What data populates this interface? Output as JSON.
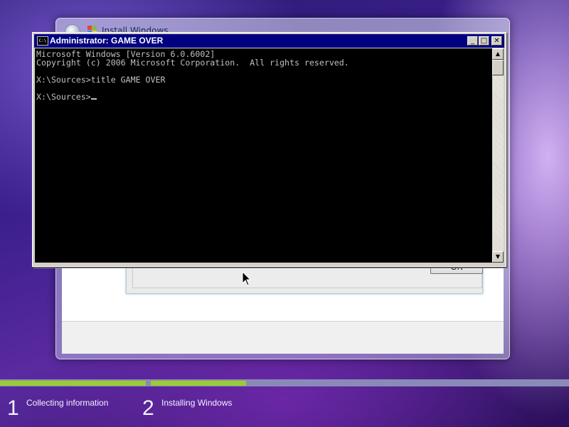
{
  "install_window": {
    "title": "Install Windows",
    "dialog": {
      "ok_label": "OK"
    }
  },
  "console": {
    "title": "Administrator:  GAME OVER",
    "icon": "cmd-icon",
    "icon_text": "C:\\",
    "buttons": {
      "minimize": "_",
      "maximize": "□",
      "close": "✕"
    },
    "lines": [
      "Microsoft Windows [Version 6.0.6002]",
      "Copyright (c) 2006 Microsoft Corporation.  All rights reserved.",
      "",
      "X:\\Sources>title GAME OVER",
      "",
      "X:\\Sources>"
    ]
  },
  "progress": {
    "steps": [
      {
        "number": "1",
        "label": "Collecting information",
        "fill_fraction": 1.0
      },
      {
        "number": "2",
        "label": "Installing Windows",
        "fill_fraction": 0.23
      }
    ],
    "colors": {
      "filled": "#9acd32",
      "track": "#8a8ab8"
    }
  }
}
